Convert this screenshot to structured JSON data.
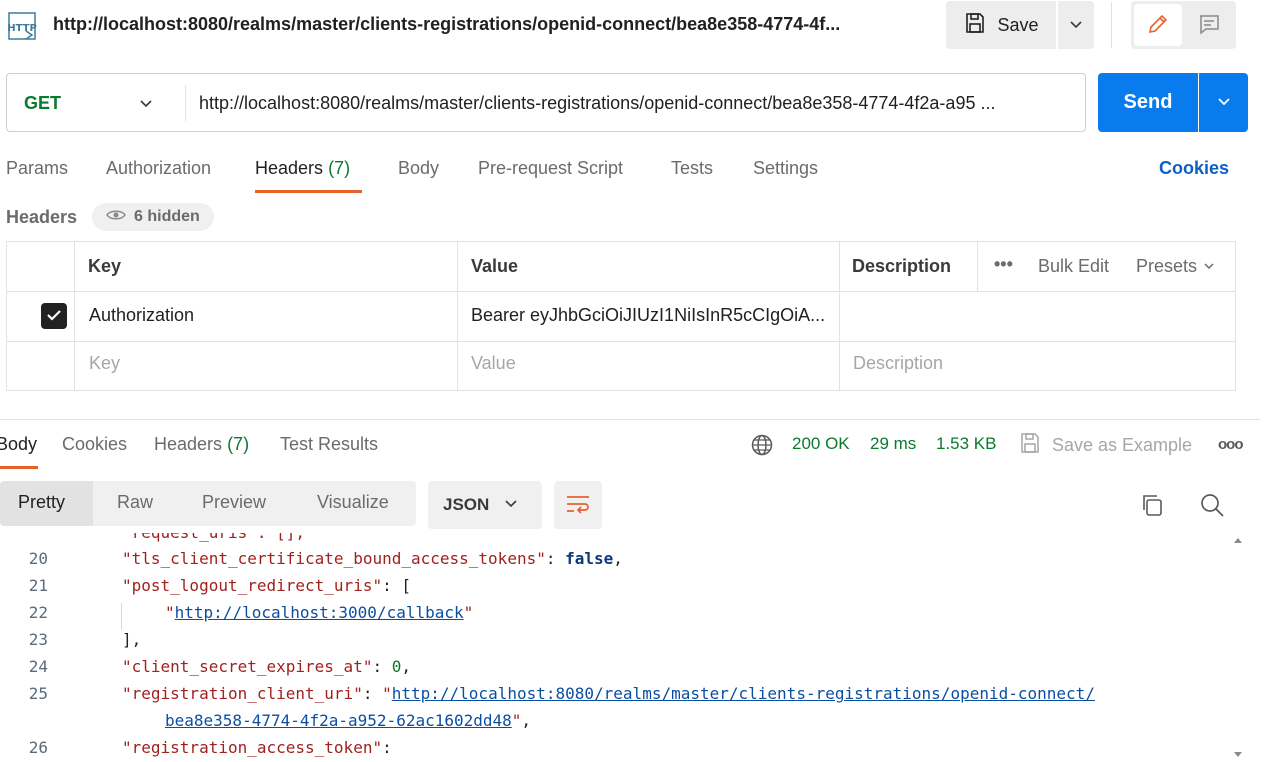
{
  "request": {
    "title": "http://localhost:8080/realms/master/clients-registrations/openid-connect/bea8e358-4774-4f...",
    "method": "GET",
    "url": "http://localhost:8080/realms/master/clients-registrations/openid-connect/bea8e358-4774-4f2a-a95 ..."
  },
  "toolbar": {
    "save_label": "Save",
    "send_label": "Send"
  },
  "request_tabs": {
    "params": "Params",
    "authorization": "Authorization",
    "headers": "Headers",
    "headers_count": "(7)",
    "body": "Body",
    "prerequest": "Pre-request Script",
    "tests": "Tests",
    "settings": "Settings",
    "cookies": "Cookies"
  },
  "headers_section": {
    "label": "Headers",
    "hidden": "6 hidden",
    "columns": {
      "key": "Key",
      "value": "Value",
      "description": "Description",
      "more": "•••",
      "bulk_edit": "Bulk Edit",
      "presets": "Presets"
    },
    "rows": [
      {
        "key": "Authorization",
        "value": "Bearer eyJhbGciOiJIUzI1NiIsInR5cCIgOiA..."
      }
    ],
    "placeholders": {
      "key": "Key",
      "value": "Value",
      "description": "Description"
    }
  },
  "response_tabs": {
    "body": "Body",
    "cookies": "Cookies",
    "headers": "Headers",
    "headers_count": "(7)",
    "test_results": "Test Results"
  },
  "response_status": {
    "status": "200 OK",
    "time": "29 ms",
    "size": "1.53 KB",
    "save_example": "Save as Example",
    "more": "ooo"
  },
  "view": {
    "pretty": "Pretty",
    "raw": "Raw",
    "preview": "Preview",
    "visualize": "Visualize",
    "format": "JSON"
  },
  "code": {
    "lines": [
      {
        "n": "20",
        "key": "\"tls_client_certificate_bound_access_tokens\"",
        "sep": ": ",
        "val": "false",
        "end": ","
      },
      {
        "n": "21",
        "key": "\"post_logout_redirect_uris\"",
        "sep": ": ",
        "val": "[",
        "end": ""
      },
      {
        "n": "22",
        "q1": "\"",
        "link": "http://localhost:3000/callback",
        "q2": "\""
      },
      {
        "n": "23",
        "text": "],"
      },
      {
        "n": "24",
        "key": "\"client_secret_expires_at\"",
        "sep": ": ",
        "val": "0",
        "end": ","
      },
      {
        "n": "25",
        "key": "\"registration_client_uri\"",
        "sep": ": ",
        "q1": "\"",
        "link": "http://localhost:8080/realms/master/clients-registrations/openid-connect/",
        "cont": "bea8e358-4774-4f2a-a952-62ac1602dd48",
        "q2": "\"",
        "end": ","
      },
      {
        "n": "26",
        "key": "\"registration_access_token\"",
        "sep": ":"
      }
    ],
    "partial_top": "\"request_uris\": [],"
  },
  "colors": {
    "accent": "#e8612c",
    "send": "#097bed",
    "success": "#0a7a2f",
    "link": "#0b62c4"
  }
}
